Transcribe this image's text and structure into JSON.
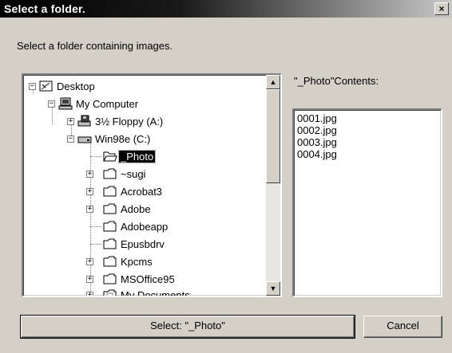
{
  "window": {
    "title": "Select a folder.",
    "close_label": "×"
  },
  "instruction": "Select a folder containing images.",
  "tree": {
    "items": [
      {
        "label": "Desktop",
        "icon": "desktop-icon",
        "expander": "−"
      },
      {
        "label": "My Computer",
        "icon": "computer-icon",
        "expander": "−"
      },
      {
        "label": "3½ Floppy (A:)",
        "icon": "floppy-drive-icon",
        "expander": "+"
      },
      {
        "label": "Win98e (C:)",
        "icon": "hard-drive-icon",
        "expander": "−"
      },
      {
        "label": "_Photo",
        "icon": "open-folder-icon",
        "expander": "",
        "selected": true
      },
      {
        "label": "~sugi",
        "icon": "folder-icon",
        "expander": "+"
      },
      {
        "label": "Acrobat3",
        "icon": "folder-icon",
        "expander": "+"
      },
      {
        "label": "Adobe",
        "icon": "folder-icon",
        "expander": "+"
      },
      {
        "label": "Adobeapp",
        "icon": "folder-icon",
        "expander": ""
      },
      {
        "label": "Epusbdrv",
        "icon": "folder-icon",
        "expander": ""
      },
      {
        "label": "Kpcms",
        "icon": "folder-icon",
        "expander": "+"
      },
      {
        "label": "MSOffice95",
        "icon": "folder-icon",
        "expander": "+"
      },
      {
        "label": "My Documents",
        "icon": "documents-folder-icon",
        "expander": "+"
      }
    ],
    "scroll_up": "▲",
    "scroll_down": "▼"
  },
  "contents": {
    "label": "\"_Photo\"Contents:",
    "files": [
      "0001.jpg",
      "0002.jpg",
      "0003.jpg",
      "0004.jpg"
    ]
  },
  "buttons": {
    "select_label": "Select: \"_Photo\"",
    "cancel_label": "Cancel"
  }
}
